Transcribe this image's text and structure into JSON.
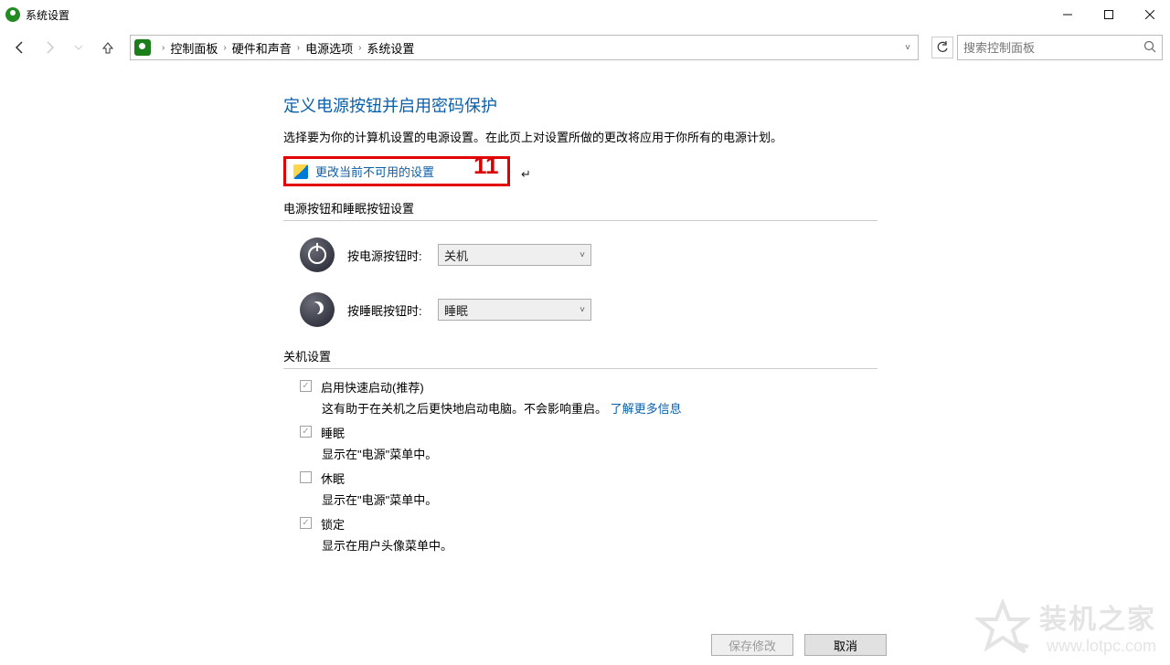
{
  "window": {
    "title": "系统设置"
  },
  "breadcrumb": {
    "p1": "控制面板",
    "p2": "硬件和声音",
    "p3": "电源选项",
    "p4": "系统设置"
  },
  "search": {
    "placeholder": "搜索控制面板"
  },
  "main": {
    "heading": "定义电源按钮并启用密码保护",
    "description": "选择要为你的计算机设置的电源设置。在此页上对设置所做的更改将应用于你所有的电源计划。",
    "change_link": "更改当前不可用的设置",
    "annotation": "11",
    "section1_title": "电源按钮和睡眠按钮设置",
    "power_button_label": "按电源按钮时:",
    "power_button_value": "关机",
    "sleep_button_label": "按睡眠按钮时:",
    "sleep_button_value": "睡眠",
    "section2_title": "关机设置",
    "fast_startup_label": "启用快速启动(推荐)",
    "fast_startup_desc_a": "这有助于在关机之后更快地启动电脑。不会影响重启。",
    "fast_startup_link": "了解更多信息",
    "sleep_label": "睡眠",
    "sleep_desc": "显示在\"电源\"菜单中。",
    "hibernate_label": "休眠",
    "hibernate_desc": "显示在\"电源\"菜单中。",
    "lock_label": "锁定",
    "lock_desc": "显示在用户头像菜单中。"
  },
  "footer": {
    "save": "保存修改",
    "cancel": "取消"
  },
  "watermark": {
    "cn": "装机之家",
    "url": "www.lotpc.com"
  }
}
